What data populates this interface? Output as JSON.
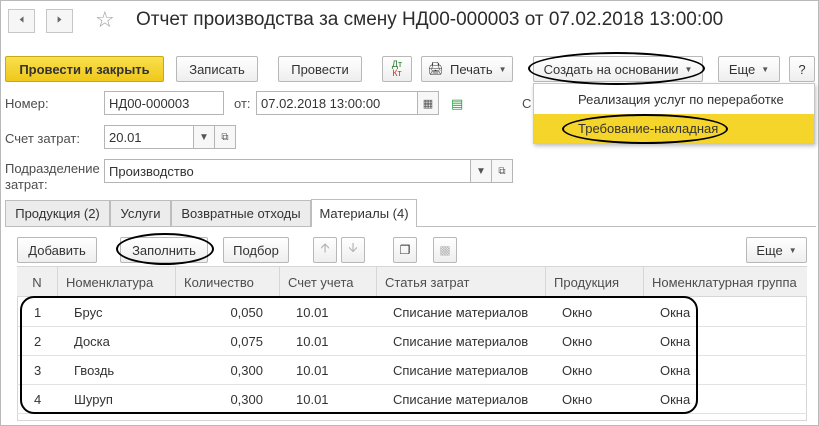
{
  "window": {
    "title": "Отчет производства за смену НД00-000003 от 07.02.2018 13:00:00"
  },
  "toolbar": {
    "post_and_close": "Провести и закрыть",
    "save": "Записать",
    "post": "Провести",
    "dt_kt": "Дт\nКт",
    "print": "Печать",
    "create_based_on": "Создать на основании",
    "more": "Еще",
    "help": "?"
  },
  "create_menu": {
    "items": [
      "Реализация услуг по переработке",
      "Требование-накладная"
    ],
    "selected_index": 1
  },
  "form": {
    "number_label": "Номер:",
    "number_value": "НД00-000003",
    "date_label": "от:",
    "date_value": "07.02.2018 13:00:00",
    "cut_label": "С",
    "cost_account_label": "Счет затрат:",
    "cost_account_value": "20.01",
    "division_label_1": "Подразделение",
    "division_label_2": "затрат:",
    "division_value": "Производство"
  },
  "tabs": [
    {
      "label": "Продукция (2)",
      "active": false
    },
    {
      "label": "Услуги",
      "active": false
    },
    {
      "label": "Возвратные отходы",
      "active": false
    },
    {
      "label": "Материалы (4)",
      "active": true
    }
  ],
  "table_toolbar": {
    "add": "Добавить",
    "fill": "Заполнить",
    "select": "Подбор",
    "more": "Еще"
  },
  "table": {
    "columns": [
      "N",
      "Номенклатура",
      "Количество",
      "Счет учета",
      "Статья затрат",
      "Продукция",
      "Номенклатурная группа"
    ],
    "rows": [
      {
        "n": "1",
        "item": "Брус",
        "qty": "0,050",
        "account": "10.01",
        "cost_item": "Списание материалов",
        "product": "Окно",
        "group": "Окна"
      },
      {
        "n": "2",
        "item": "Доска",
        "qty": "0,075",
        "account": "10.01",
        "cost_item": "Списание материалов",
        "product": "Окно",
        "group": "Окна"
      },
      {
        "n": "3",
        "item": "Гвоздь",
        "qty": "0,300",
        "account": "10.01",
        "cost_item": "Списание материалов",
        "product": "Окно",
        "group": "Окна"
      },
      {
        "n": "4",
        "item": "Шуруп",
        "qty": "0,300",
        "account": "10.01",
        "cost_item": "Списание материалов",
        "product": "Окно",
        "group": "Окна"
      }
    ]
  },
  "colors": {
    "primary_button": "#f0c81b",
    "menu_highlight": "#f5d52a",
    "annotation": "#000000"
  }
}
